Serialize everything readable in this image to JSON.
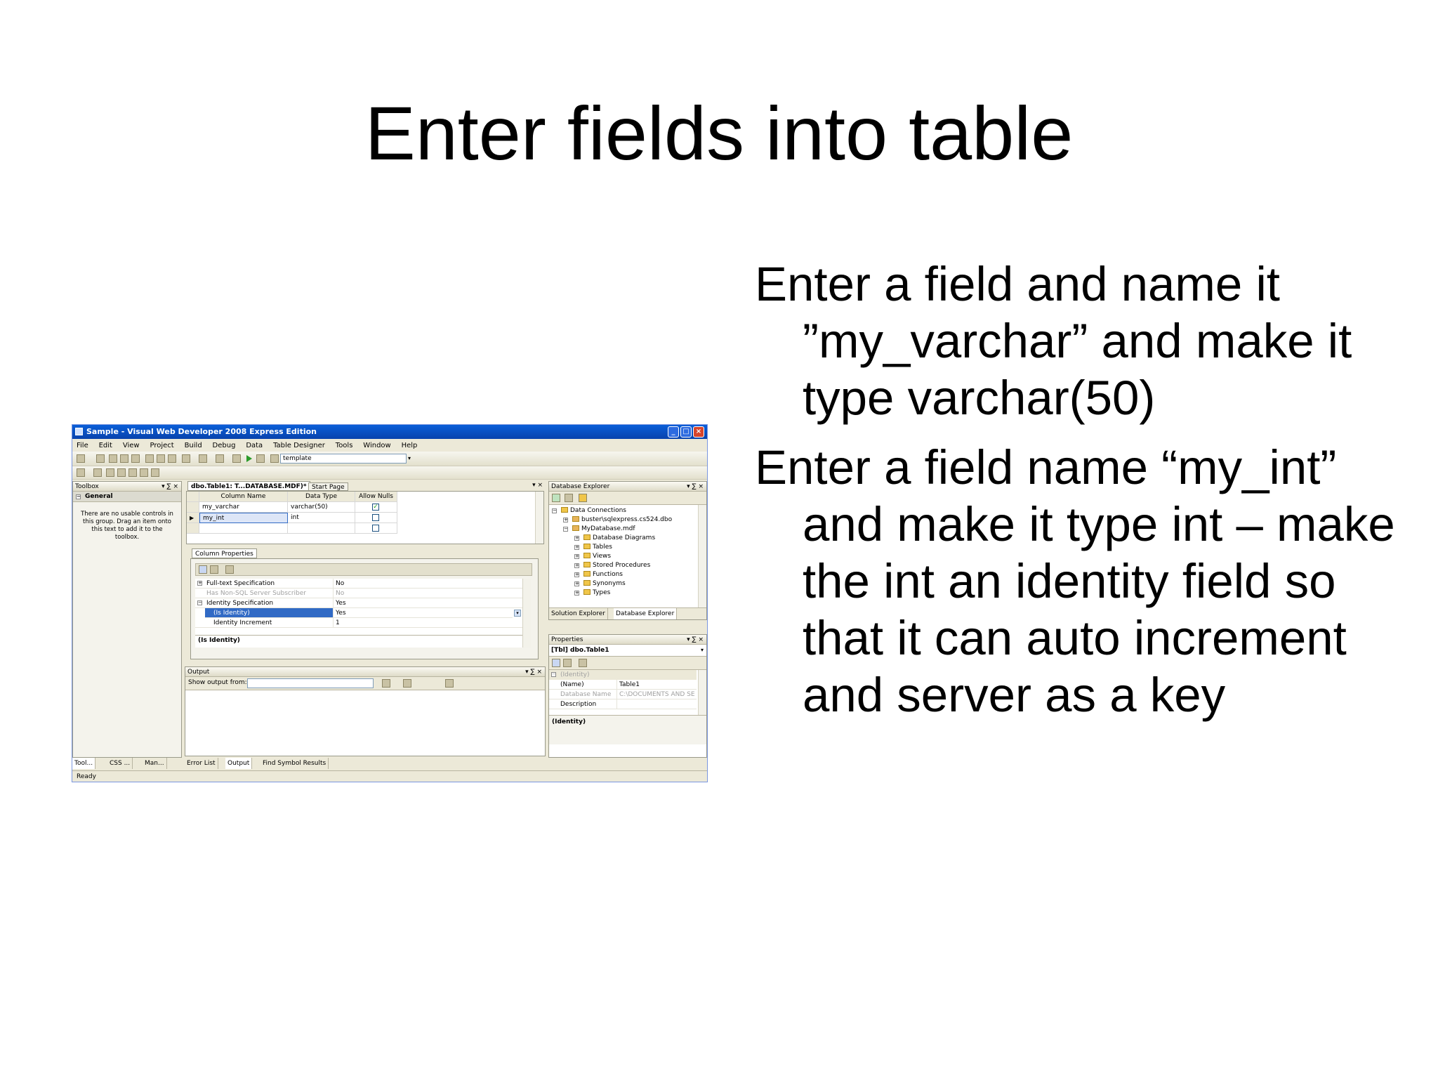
{
  "slide": {
    "title": "Enter fields into table",
    "bullets": [
      "Enter a field and name it ”my_varchar” and make it type varchar(50)",
      "Enter a field name “my_int” and make it type int – make the int an identity field so that it can auto increment and server as a key"
    ]
  },
  "app": {
    "window_title": "Sample - Visual Web Developer 2008 Express Edition",
    "menu": [
      "File",
      "Edit",
      "View",
      "Project",
      "Build",
      "Debug",
      "Data",
      "Table Designer",
      "Tools",
      "Window",
      "Help"
    ],
    "toolbar_combo": "template",
    "toolbox": {
      "title": "Toolbox",
      "group": "General",
      "empty_text": "There are no usable controls in this group. Drag an item onto this text to add it to the toolbox."
    },
    "doc_tabs": [
      "dbo.Table1: T...DATABASE.MDF)*",
      "Start Page"
    ],
    "table_designer": {
      "headers": [
        "Column Name",
        "Data Type",
        "Allow Nulls"
      ],
      "rows": [
        {
          "name": "my_varchar",
          "type": "varchar(50)",
          "nulls": "✓"
        },
        {
          "name": "my_int",
          "type": "int",
          "nulls": ""
        }
      ]
    },
    "column_properties": {
      "tab": "Column Properties",
      "rows": [
        {
          "key": "Full-text Specification",
          "value": "No"
        },
        {
          "key": "Has Non-SQL Server Subscriber",
          "value": "No"
        },
        {
          "key": "Identity Specification",
          "value": "Yes"
        },
        {
          "key": "(Is Identity)",
          "value": "Yes"
        },
        {
          "key": "Identity Increment",
          "value": "1"
        }
      ],
      "footer": "(Is Identity)"
    },
    "output": {
      "title": "Output",
      "show_from_label": "Show output from:"
    },
    "database_explorer": {
      "title": "Database Explorer",
      "items": [
        "Data Connections",
        "buster\\sqlexpress.cs524.dbo",
        "MyDatabase.mdf",
        "Database Diagrams",
        "Tables",
        "Views",
        "Stored Procedures",
        "Functions",
        "Synonyms",
        "Types"
      ],
      "tabs": [
        "Solution Explorer",
        "Database Explorer"
      ]
    },
    "properties": {
      "title": "Properties",
      "object": "[Tbl] dbo.Table1",
      "group": "(Identity)",
      "rows": [
        {
          "key": "(Name)",
          "value": "Table1"
        },
        {
          "key": "Database Name",
          "value": "C:\\DOCUMENTS AND SE"
        },
        {
          "key": "Description",
          "value": ""
        }
      ],
      "footer": "(Identity)"
    },
    "bottom_tabs_left": [
      "Tool...",
      "CSS ...",
      "Man..."
    ],
    "bottom_tabs_right": [
      "Error List",
      "Output",
      "Find Symbol Results"
    ],
    "status": "Ready"
  }
}
